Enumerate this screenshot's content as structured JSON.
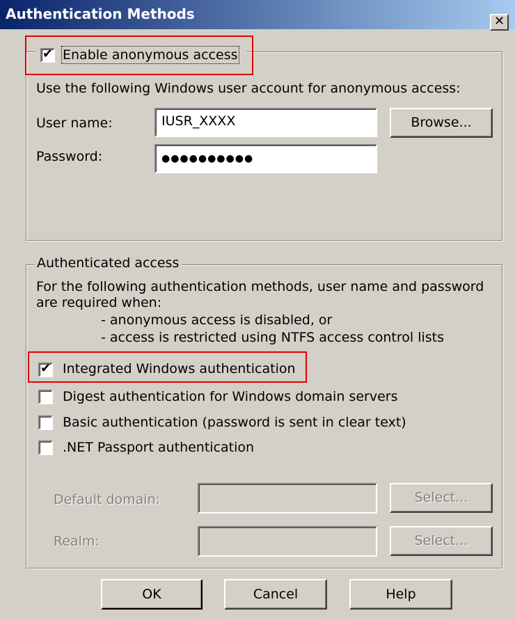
{
  "window": {
    "title": "Authentication Methods",
    "close_label": "✕"
  },
  "anonymous": {
    "checkbox_label": "Enable anonymous access",
    "checked": true,
    "description": "Use the following Windows user account for anonymous access:",
    "username_label": "User name:",
    "username_value": "IUSR_XXXX",
    "browse_label": "Browse...",
    "password_label": "Password:",
    "password_value": "●●●●●●●●●●"
  },
  "authenticated": {
    "group_title": "Authenticated access",
    "description_line1": "For the following authentication methods, user name and password",
    "description_line2": "are required when:",
    "bullet1": "- anonymous access is disabled, or",
    "bullet2": "- access is restricted using NTFS access control lists",
    "methods": [
      {
        "label": "Integrated Windows authentication",
        "checked": true
      },
      {
        "label": "Digest authentication for Windows domain servers",
        "checked": false
      },
      {
        "label": "Basic authentication (password is sent in clear text)",
        "checked": false
      },
      {
        "label": ".NET Passport authentication",
        "checked": false
      }
    ],
    "default_domain_label": "Default domain:",
    "realm_label": "Realm:",
    "select_label": "Select..."
  },
  "buttons": {
    "ok": "OK",
    "cancel": "Cancel",
    "help": "Help"
  },
  "colors": {
    "highlight": "#e00000",
    "title_start": "#0a246a",
    "title_end": "#a6caf0"
  }
}
